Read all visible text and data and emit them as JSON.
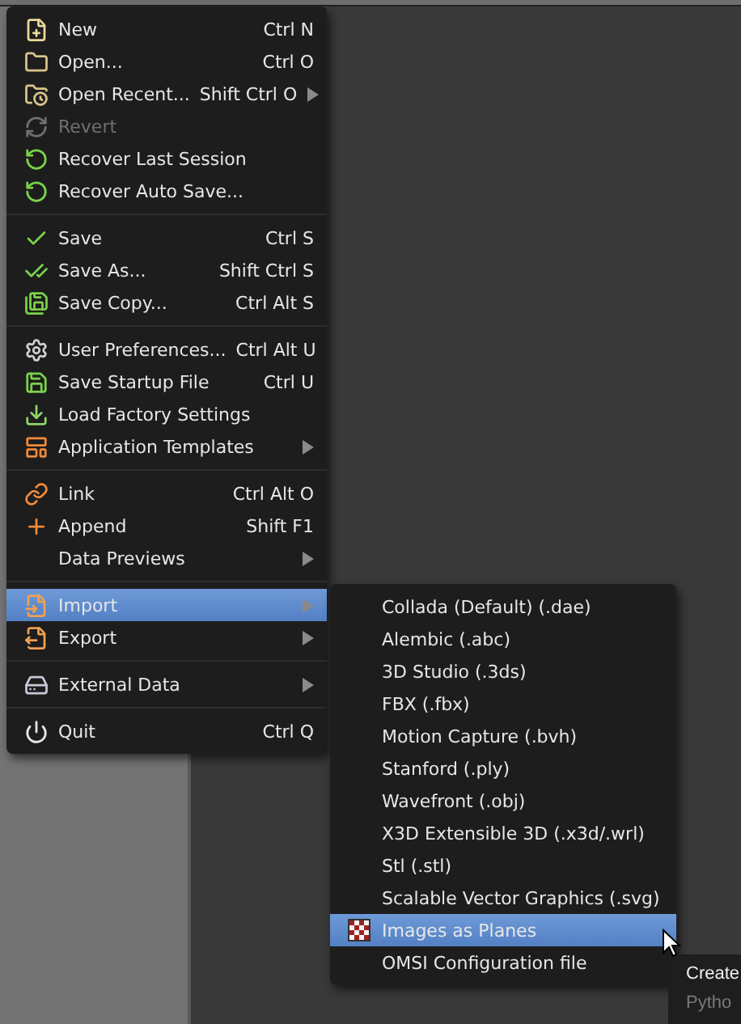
{
  "file_menu": {
    "sections": [
      {
        "items": [
          {
            "label": "New",
            "shortcut": "Ctrl N",
            "submenu": false,
            "disabled": false,
            "selected": false
          },
          {
            "label": "Open...",
            "shortcut": "Ctrl O",
            "submenu": false,
            "disabled": false,
            "selected": false
          },
          {
            "label": "Open Recent...",
            "shortcut": "Shift Ctrl O",
            "submenu": true,
            "disabled": false,
            "selected": false
          },
          {
            "label": "Revert",
            "submenu": false,
            "disabled": true,
            "selected": false
          },
          {
            "label": "Recover Last Session",
            "submenu": false,
            "disabled": false,
            "selected": false
          },
          {
            "label": "Recover Auto Save...",
            "submenu": false,
            "disabled": false,
            "selected": false
          }
        ]
      },
      {
        "items": [
          {
            "label": "Save",
            "shortcut": "Ctrl S",
            "submenu": false,
            "disabled": false,
            "selected": false
          },
          {
            "label": "Save As...",
            "shortcut": "Shift Ctrl S",
            "submenu": false,
            "disabled": false,
            "selected": false
          },
          {
            "label": "Save Copy...",
            "shortcut": "Ctrl Alt S",
            "submenu": false,
            "disabled": false,
            "selected": false
          }
        ]
      },
      {
        "items": [
          {
            "label": "User Preferences...",
            "shortcut": "Ctrl Alt U",
            "submenu": false,
            "disabled": false,
            "selected": false
          },
          {
            "label": "Save Startup File",
            "shortcut": "Ctrl U",
            "submenu": false,
            "disabled": false,
            "selected": false
          },
          {
            "label": "Load Factory Settings",
            "submenu": false,
            "disabled": false,
            "selected": false
          },
          {
            "label": "Application Templates",
            "submenu": true,
            "disabled": false,
            "selected": false
          }
        ]
      },
      {
        "items": [
          {
            "label": "Link",
            "shortcut": "Ctrl Alt O",
            "submenu": false,
            "disabled": false,
            "selected": false
          },
          {
            "label": "Append",
            "shortcut": "Shift F1",
            "submenu": false,
            "disabled": false,
            "selected": false
          },
          {
            "label": "Data Previews",
            "submenu": true,
            "disabled": false,
            "selected": false
          }
        ]
      },
      {
        "items": [
          {
            "label": "Import",
            "submenu": true,
            "disabled": false,
            "selected": true
          },
          {
            "label": "Export",
            "submenu": true,
            "disabled": false,
            "selected": false
          }
        ]
      },
      {
        "items": [
          {
            "label": "External Data",
            "submenu": true,
            "disabled": false,
            "selected": false
          }
        ]
      },
      {
        "items": [
          {
            "label": "Quit",
            "shortcut": "Ctrl Q",
            "submenu": false,
            "disabled": false,
            "selected": false
          }
        ]
      }
    ]
  },
  "import_submenu": {
    "items": [
      {
        "label": "Collada (Default) (.dae)",
        "selected": false
      },
      {
        "label": "Alembic (.abc)",
        "selected": false
      },
      {
        "label": "3D Studio (.3ds)",
        "selected": false
      },
      {
        "label": "FBX (.fbx)",
        "selected": false
      },
      {
        "label": "Motion Capture (.bvh)",
        "selected": false
      },
      {
        "label": "Stanford (.ply)",
        "selected": false
      },
      {
        "label": "Wavefront (.obj)",
        "selected": false
      },
      {
        "label": "X3D Extensible 3D (.x3d/.wrl)",
        "selected": false
      },
      {
        "label": "Stl (.stl)",
        "selected": false
      },
      {
        "label": "Scalable Vector Graphics (.svg)",
        "selected": false
      },
      {
        "label": "Images as Planes",
        "selected": true
      },
      {
        "label": "OMSI Configuration file",
        "selected": false
      }
    ]
  },
  "tooltip": {
    "title": "Create",
    "python": "Pytho"
  }
}
